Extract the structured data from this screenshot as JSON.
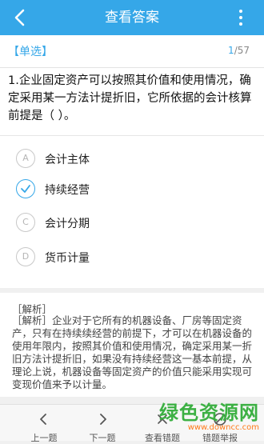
{
  "header": {
    "title": "查看答案"
  },
  "question_card": {
    "type_label": "【单选】",
    "progress_current": "1",
    "progress_total": "/57",
    "question_text": "1.企业固定资产可以按照其价值和使用情况，确定采用某一方法计提折旧，它所依据的会计核算前提是（ ）。"
  },
  "options": [
    {
      "letter": "A",
      "label": "会计主体",
      "selected": false
    },
    {
      "letter": "",
      "label": "持续经营",
      "selected": true
    },
    {
      "letter": "C",
      "label": "会计分期",
      "selected": false
    },
    {
      "letter": "D",
      "label": "货币计量",
      "selected": false
    }
  ],
  "analysis": {
    "title": "［解析］",
    "text": "［解析］企业对于它所有的机器设备、厂房等固定资产，只有在持续续经营的前提下，才可以在机器设备的使用年限内，按照其价值和使用情况，确定采用某一折旧方法计提折旧，如果没有持续经营这一基本前提，从理论上说，机器设备等固定资产的价值只能采用实现可变现价值来予以计量。"
  },
  "bottom_bar": {
    "prev": "上一题",
    "next": "下一题",
    "wrong": "查看错题",
    "report": "错题举报"
  },
  "watermark": {
    "text": "绿色资源网",
    "url": "www.downcc.com"
  },
  "colors": {
    "accent": "#35a7e8",
    "watermark_green": "#3cb043",
    "watermark_orange": "#ff7a1a"
  }
}
